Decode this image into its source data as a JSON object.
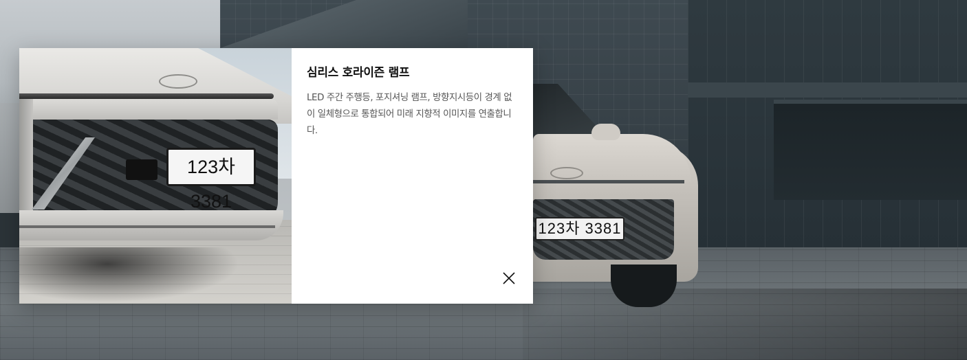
{
  "modal": {
    "title": "심리스 호라이즌 램프",
    "description": "LED 주간 주행등, 포지셔닝 램프, 방향지시등이 경계 없이 일체형으로 통합되어 미래 지향적 이미지를 연출합니다.",
    "image_plate_text": "123차 3381",
    "close_icon": "close-icon"
  },
  "background": {
    "plate_text": "123차 3381"
  }
}
